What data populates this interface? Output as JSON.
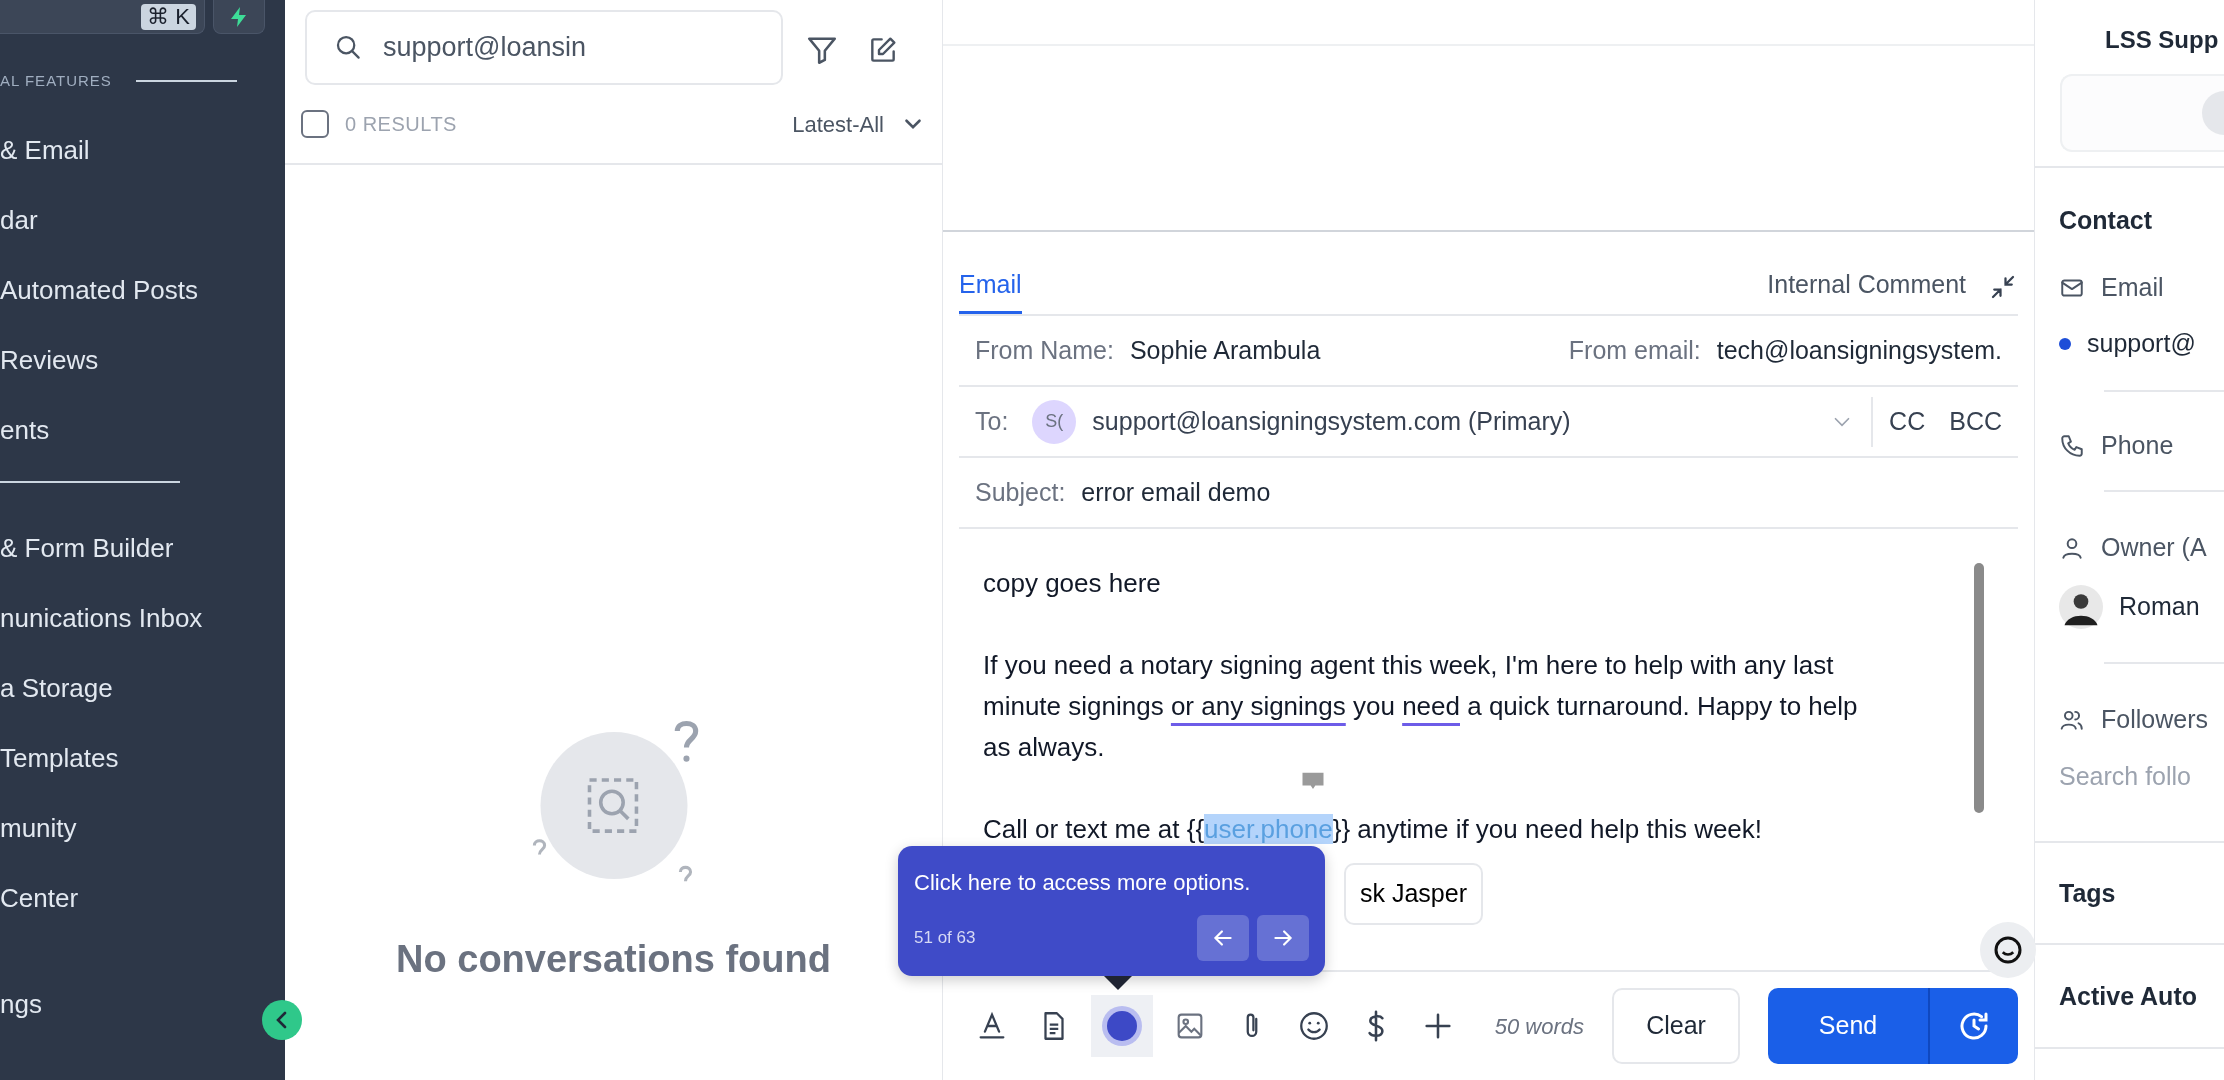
{
  "sidebar": {
    "shortcut": "⌘ K",
    "section_label": "AL FEATURES",
    "groups": [
      {
        "divider": true,
        "items": [
          {
            "label": "& Email"
          },
          {
            "label": "dar"
          },
          {
            "label": "Automated Posts"
          },
          {
            "label": "Reviews"
          },
          {
            "label": "ents"
          }
        ]
      },
      {
        "divider": false,
        "items": [
          {
            "label": "& Form Builder"
          },
          {
            "label": "nunications Inbox"
          },
          {
            "label": "a Storage"
          },
          {
            "label": "Templates"
          },
          {
            "label": "munity"
          },
          {
            "label": "Center"
          }
        ]
      },
      {
        "divider": false,
        "items": [
          {
            "label": "ngs"
          }
        ]
      }
    ]
  },
  "conversation_list": {
    "search": {
      "value": "support@loansin"
    },
    "select_all_checked": false,
    "results": "0 RESULTS",
    "sort": "Latest-All",
    "empty_message": "No conversations found"
  },
  "composer": {
    "tabs": [
      {
        "label": "Email",
        "selected": true
      },
      {
        "label": "Internal Comment",
        "selected": false
      }
    ],
    "from_name_label": "From Name:",
    "from_name": "Sophie Arambula",
    "from_email_label": "From email:",
    "from_email": "tech@loansigningsystem.",
    "to_label": "To:",
    "recipient_initials": "S(",
    "recipient": "support@loansigningsystem.com (Primary)",
    "cc": "CC",
    "bcc": "BCC",
    "subject_label": "Subject:",
    "subject": "error email demo",
    "body": [
      {
        "segments": [
          {
            "text": "copy goes here",
            "kind": "plain"
          }
        ]
      },
      {
        "segments": [
          {
            "text": "If you need a notary signing agent this week, I'm here to help with any last minute signings ",
            "kind": "plain"
          },
          {
            "text": "or any signings",
            "kind": "underline"
          },
          {
            "text": " you ",
            "kind": "plain"
          },
          {
            "text": "need",
            "kind": "underline"
          },
          {
            "text": " a quick turnaround. Happy to help as always.",
            "kind": "plain"
          }
        ]
      },
      {
        "segments": [
          {
            "text": "Call or text me at {{",
            "kind": "plain"
          },
          {
            "text": "user.phone",
            "kind": "highlight"
          },
          {
            "text": "}} anytime if you need help this week!",
            "kind": "plain"
          }
        ]
      }
    ],
    "ask_jasper": "sk Jasper",
    "word_count": "50 words",
    "clear": "Clear",
    "send": "Send"
  },
  "tour": {
    "text": "Click here to access more options.",
    "step": "51 of 63"
  },
  "contact_panel": {
    "title": "LSS Supp",
    "section": "Contact",
    "email_label": "Email",
    "email": "support@",
    "phone_label": "Phone",
    "owner_label": "Owner (A",
    "owner": "Roman",
    "followers_label": "Followers",
    "followers_placeholder": "Search follo",
    "sections": [
      {
        "label": "Tags"
      },
      {
        "label": "Active Auto"
      }
    ]
  }
}
